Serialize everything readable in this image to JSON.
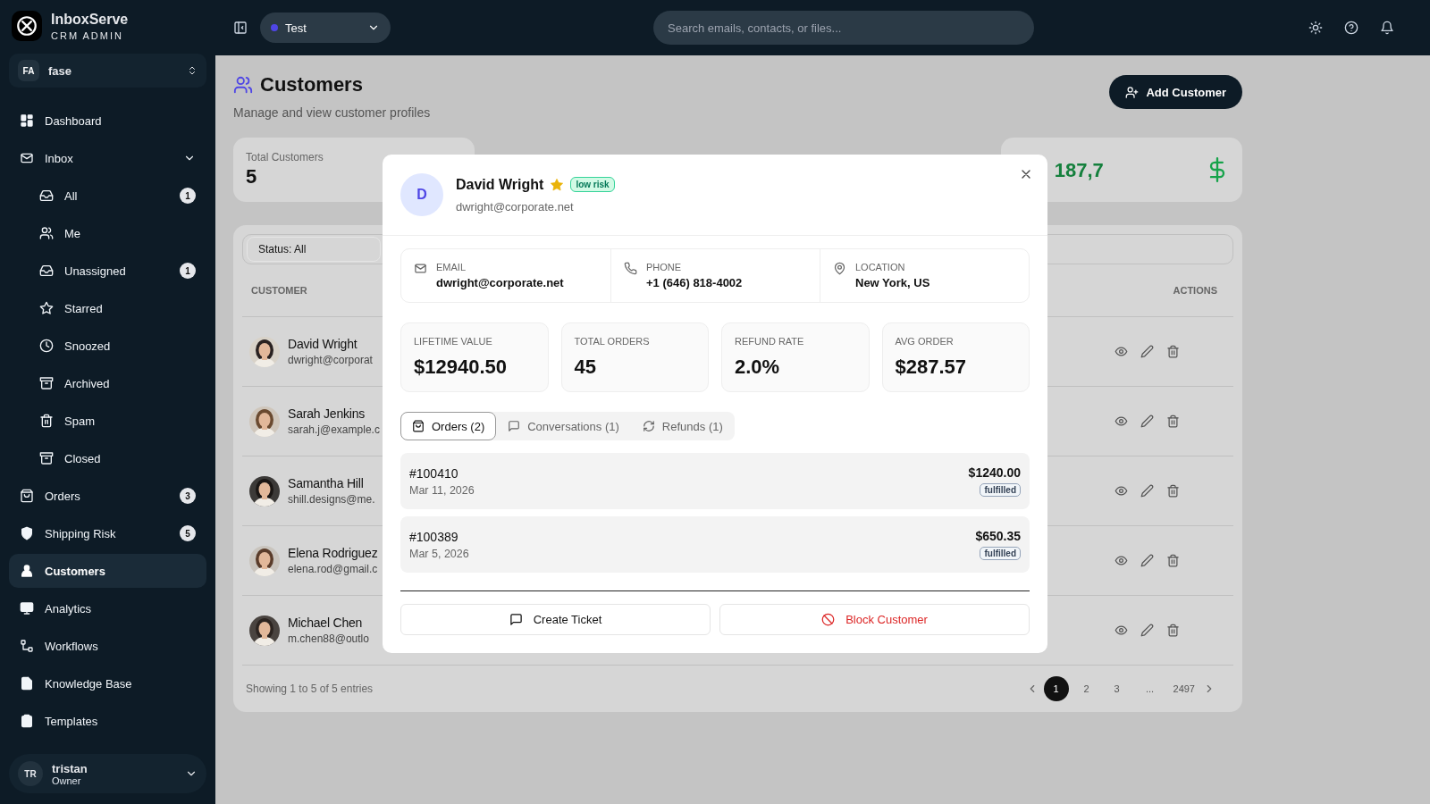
{
  "app": {
    "name": "InboxServe",
    "subtitle": "CRM ADMIN"
  },
  "workspace_switcher": {
    "initials": "FA",
    "name": "fase"
  },
  "sidebar": {
    "items": [
      {
        "label": "Dashboard",
        "selected": false
      },
      {
        "label": "Inbox",
        "selected": false,
        "expanded": true,
        "children": [
          {
            "label": "All",
            "count": "1",
            "selected": false
          },
          {
            "label": "Me",
            "selected": false
          },
          {
            "label": "Unassigned",
            "count": "1",
            "selected": false
          },
          {
            "label": "Starred",
            "selected": false
          },
          {
            "label": "Snoozed",
            "selected": false
          },
          {
            "label": "Archived",
            "selected": false
          },
          {
            "label": "Spam",
            "selected": false
          },
          {
            "label": "Closed",
            "selected": false
          }
        ]
      },
      {
        "label": "Orders",
        "count": "3",
        "selected": false
      },
      {
        "label": "Shipping Risk",
        "count": "5",
        "selected": false
      },
      {
        "label": "Customers",
        "selected": true
      },
      {
        "label": "Analytics",
        "selected": false
      },
      {
        "label": "Workflows",
        "selected": false
      },
      {
        "label": "Knowledge Base",
        "selected": false
      },
      {
        "label": "Templates",
        "selected": false
      }
    ]
  },
  "user": {
    "initials": "TR",
    "name": "tristan",
    "role": "Owner"
  },
  "topbar": {
    "environment": "Test",
    "search": {
      "placeholder": "Search emails, contacts, or files..."
    }
  },
  "page": {
    "title": "Customers",
    "subtitle": "Manage and view customer profiles",
    "add_button": "Add Customer"
  },
  "stat_cards": [
    {
      "kind": "count",
      "label": "Total Customers",
      "value": "5"
    },
    {
      "kind": "revenue",
      "value": "187,7"
    }
  ],
  "filters": {
    "status": "Status: All"
  },
  "table": {
    "columns": [
      "CUSTOMER",
      "ACTIONS"
    ],
    "rows": [
      {
        "name": "David Wright",
        "email": "dwright@corporat"
      },
      {
        "name": "Sarah Jenkins",
        "email": "sarah.j@example.c"
      },
      {
        "name": "Samantha Hill",
        "email": "shill.designs@me."
      },
      {
        "name": "Elena Rodriguez",
        "email": "elena.rod@gmail.c"
      },
      {
        "name": "Michael Chen",
        "email": "m.chen88@outlo"
      }
    ]
  },
  "footer": {
    "summary": "Showing 1 to 5 of 5 entries",
    "pages": [
      {
        "kind": "page",
        "label": "1",
        "selected": true
      },
      {
        "kind": "page",
        "label": "2",
        "selected": false
      },
      {
        "kind": "page",
        "label": "3",
        "selected": false
      },
      {
        "kind": "gap",
        "label": "..."
      },
      {
        "kind": "page",
        "label": "2497",
        "selected": false
      }
    ]
  },
  "modal": {
    "customer": {
      "initial": "D",
      "name": "David Wright",
      "starred": true,
      "risk": "low risk",
      "email": "dwright@corporate.net"
    },
    "contact": [
      {
        "label": "EMAIL",
        "value": "dwright@corporate.net"
      },
      {
        "label": "PHONE",
        "value": "+1 (646) 818-4002"
      },
      {
        "label": "LOCATION",
        "value": "New York, US"
      }
    ],
    "metrics": [
      {
        "label": "LIFETIME VALUE",
        "value": "$12940.50"
      },
      {
        "label": "TOTAL ORDERS",
        "value": "45"
      },
      {
        "label": "REFUND RATE",
        "value": "2.0%"
      },
      {
        "label": "AVG ORDER",
        "value": "$287.57"
      }
    ],
    "tabs": [
      {
        "label": "Orders (2)",
        "selected": true
      },
      {
        "label": "Conversations (1)",
        "selected": false
      },
      {
        "label": "Refunds (1)",
        "selected": false
      }
    ],
    "orders": [
      {
        "number": "#100410",
        "date": "Mar 11, 2026",
        "total": "$1240.00",
        "status": "fulfilled"
      },
      {
        "number": "#100389",
        "date": "Mar 5, 2026",
        "total": "$650.35",
        "status": "fulfilled"
      }
    ],
    "actions": [
      {
        "label": "Create Ticket",
        "kind": "default"
      },
      {
        "label": "Block Customer",
        "kind": "danger"
      }
    ]
  }
}
